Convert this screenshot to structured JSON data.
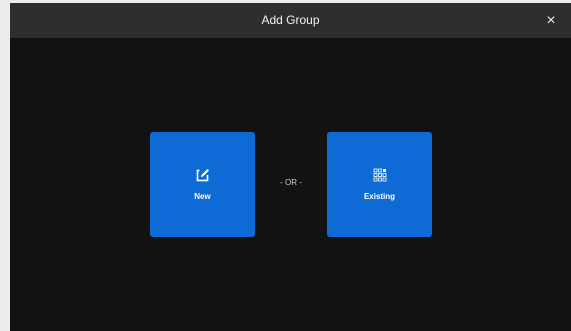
{
  "dialog": {
    "title": "Add Group",
    "close_label": "×"
  },
  "options": {
    "new_label": "New",
    "separator": "- OR -",
    "existing_label": "Existing"
  },
  "icons": {
    "new": "edit-icon",
    "existing": "grid-icon",
    "close": "close-icon"
  },
  "colors": {
    "accent": "#0e6bd6",
    "titlebar": "#2e2e2e",
    "background": "#121212"
  }
}
